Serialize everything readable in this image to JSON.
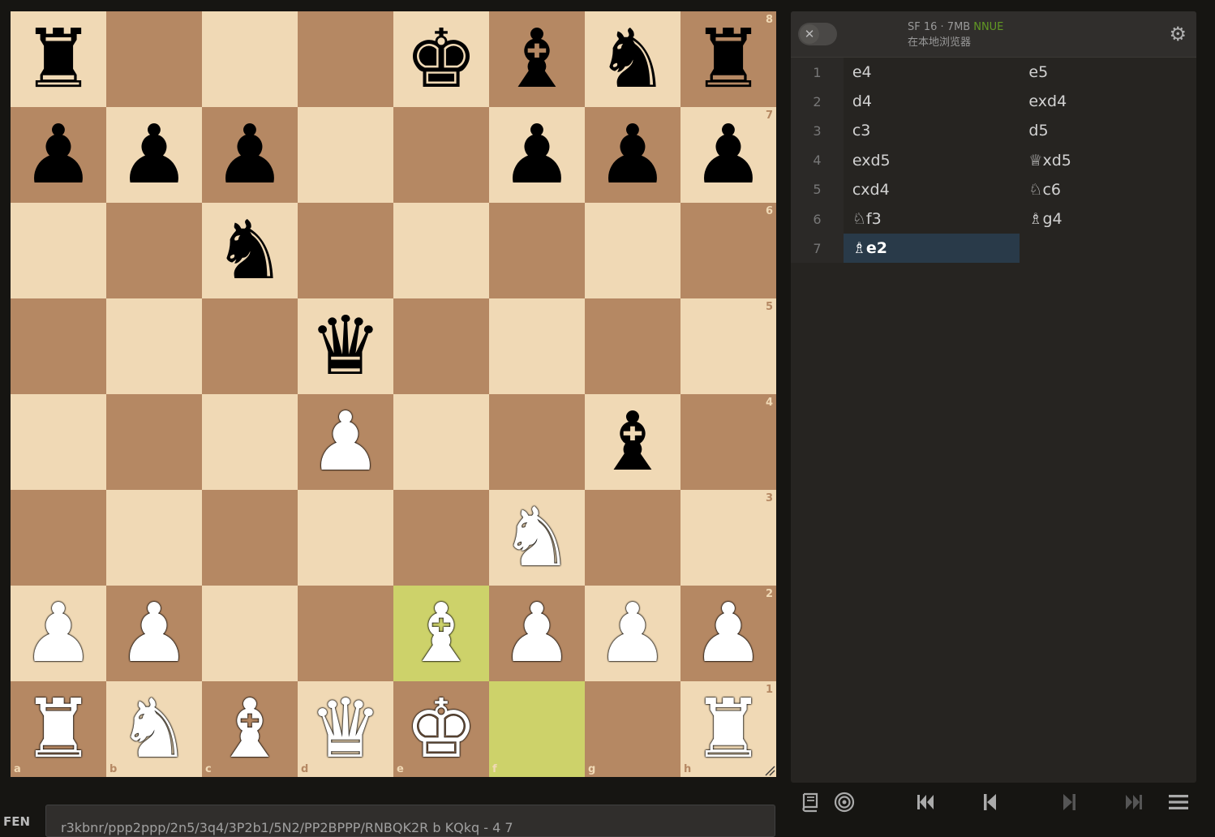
{
  "board": {
    "ranks": [
      [
        "br",
        "",
        "",
        "",
        "bk",
        "bb",
        "bn",
        "br"
      ],
      [
        "bp",
        "bp",
        "bp",
        "",
        "",
        "bp",
        "bp",
        "bp"
      ],
      [
        "",
        "",
        "bn",
        "",
        "",
        "",
        "",
        ""
      ],
      [
        "",
        "",
        "",
        "bq",
        "",
        "",
        "",
        ""
      ],
      [
        "",
        "",
        "",
        "wp",
        "",
        "",
        "bb",
        ""
      ],
      [
        "",
        "",
        "",
        "",
        "",
        "wn",
        "",
        ""
      ],
      [
        "wp",
        "wp",
        "",
        "",
        "wb",
        "wp",
        "wp",
        "wp"
      ],
      [
        "wr",
        "wn",
        "wb",
        "wq",
        "wk",
        "",
        "",
        "wr"
      ]
    ],
    "highlights": [
      "e2",
      "f1"
    ],
    "rank_labels": [
      "8",
      "7",
      "6",
      "5",
      "4",
      "3",
      "2",
      "1"
    ],
    "file_labels": [
      "a",
      "b",
      "c",
      "d",
      "e",
      "f",
      "g",
      "h"
    ]
  },
  "engine": {
    "name": "SF 16 · 7MB",
    "nnue": "NNUE",
    "location": "在本地浏览器"
  },
  "moves": [
    {
      "n": "1",
      "white": "e4",
      "black": "e5"
    },
    {
      "n": "2",
      "white": "d4",
      "black": "exd4"
    },
    {
      "n": "3",
      "white": "c3",
      "black": "d5"
    },
    {
      "n": "4",
      "white": "exd5",
      "black": "♕xd5"
    },
    {
      "n": "5",
      "white": "cxd4",
      "black": "♘c6"
    },
    {
      "n": "6",
      "white": "♘f3",
      "black": "♗g4"
    },
    {
      "n": "7",
      "white": "♗e2",
      "black": ""
    }
  ],
  "active_move": "7w",
  "fen": {
    "label": "FEN",
    "value": "r3kbnr/ppp2ppp/2n5/3q4/3P2b1/5N2/PP2BPPP/RNBQK2R b KQkq - 4 7"
  },
  "icons": {
    "toggle": "close-icon",
    "settings": "gear-icon",
    "controls": [
      "book-icon",
      "target-icon",
      "first-icon",
      "prev-icon",
      "next-icon",
      "last-icon",
      "menu-icon"
    ]
  },
  "colors": {
    "light_square": "#f0d9b5",
    "dark_square": "#b58863",
    "highlight": "#cdd26a",
    "active_move_bg": "#293a49",
    "nnue": "#629924"
  }
}
